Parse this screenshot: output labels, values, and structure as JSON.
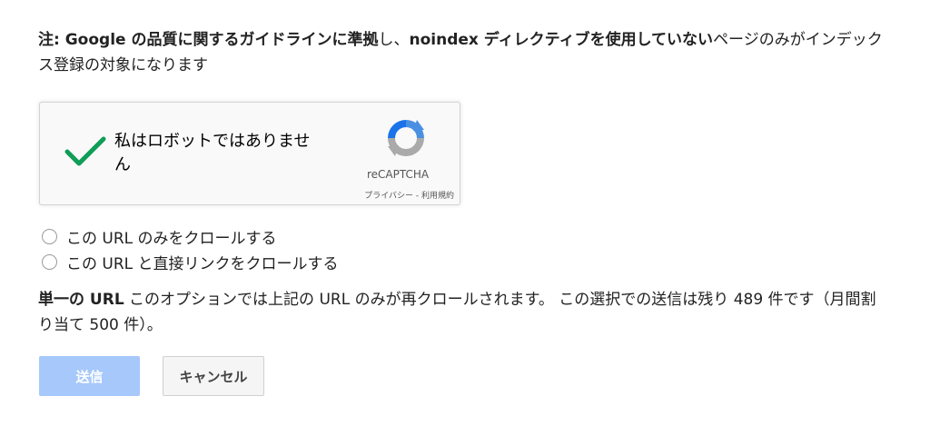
{
  "note": {
    "prefix_bold": "注: Google の品質に関するガイドラインに準拠",
    "mid": "し、",
    "noindex_bold": "noindex ディレクティブを使用していない",
    "suffix": "ページのみがインデックス登録の対象になります"
  },
  "captcha": {
    "checked": true,
    "label": "私はロボットではありません",
    "brand": "reCAPTCHA",
    "links": "プライバシー - 利用規約"
  },
  "options": [
    {
      "label": "この URL のみをクロールする",
      "selected": false
    },
    {
      "label": "この URL と直接リンクをクロールする",
      "selected": false
    }
  ],
  "info": {
    "bold": "単一の URL",
    "text": " このオプションでは上記の URL のみが再クロールされます。 この選択での送信は残り 489 件です（月間割り当て 500 件）。"
  },
  "buttons": {
    "submit_label": "送信",
    "cancel_label": "キャンセル"
  },
  "colors": {
    "check_green": "#0f9d58",
    "submit_disabled": "#a6c8fb",
    "recaptcha_blue": "#4a90e2",
    "recaptcha_gray": "#aaaaaa"
  }
}
